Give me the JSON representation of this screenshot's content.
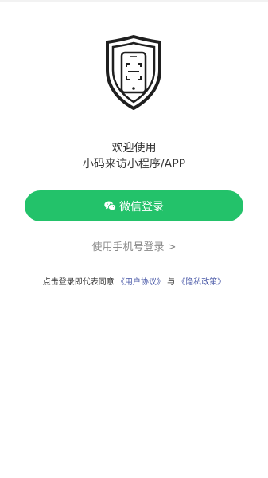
{
  "app": {
    "logo_icon": "shield-phone-scan-icon",
    "welcome_line1": "欢迎使用",
    "welcome_line2": "小码来访小程序/APP"
  },
  "login": {
    "wechat_button_label": "微信登录",
    "wechat_icon": "wechat-icon",
    "phone_login_label": "使用手机号登录 >",
    "accent_color": "#23c26a"
  },
  "agreement": {
    "prefix": "点击登录即代表同意",
    "user_agreement": "《用户协议》",
    "conjunction": "与",
    "privacy_policy": "《隐私政策》"
  }
}
